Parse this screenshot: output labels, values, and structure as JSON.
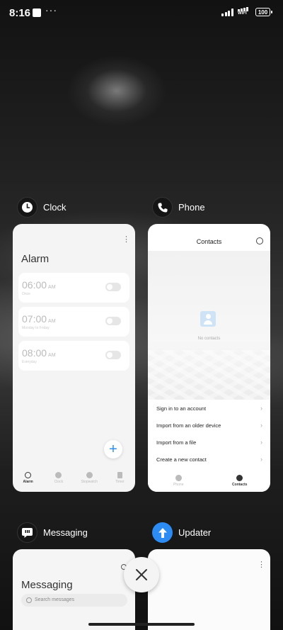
{
  "status": {
    "time": "8:16",
    "wifi_label": "WIFI",
    "battery": "100"
  },
  "cards": {
    "clock": {
      "app_name": "Clock",
      "title": "Alarm",
      "alarms": [
        {
          "time": "06:00",
          "ampm": "AM",
          "sub": "Once"
        },
        {
          "time": "07:00",
          "ampm": "AM",
          "sub": "Monday to Friday"
        },
        {
          "time": "08:00",
          "ampm": "AM",
          "sub": "Everyday"
        }
      ],
      "nav": [
        "Alarm",
        "Clock",
        "Stopwatch",
        "Timer"
      ]
    },
    "phone": {
      "app_name": "Phone",
      "title": "Contacts",
      "empty_text": "No contacts",
      "menu": [
        "Sign in to an account",
        "Import from an older device",
        "Import from a file",
        "Create a new contact"
      ],
      "nav": [
        "Phone",
        "Contacts"
      ]
    },
    "messaging": {
      "app_name": "Messaging",
      "title": "Messaging",
      "search_placeholder": "Search messages"
    },
    "updater": {
      "app_name": "Updater"
    }
  },
  "icons": {
    "clock_app": "clock-icon",
    "phone_app": "phone-icon",
    "messaging_app": "message-bubble-icon",
    "updater_app": "arrow-up-icon",
    "close": "close-icon"
  },
  "colors": {
    "accent": "#2c8cf4"
  }
}
